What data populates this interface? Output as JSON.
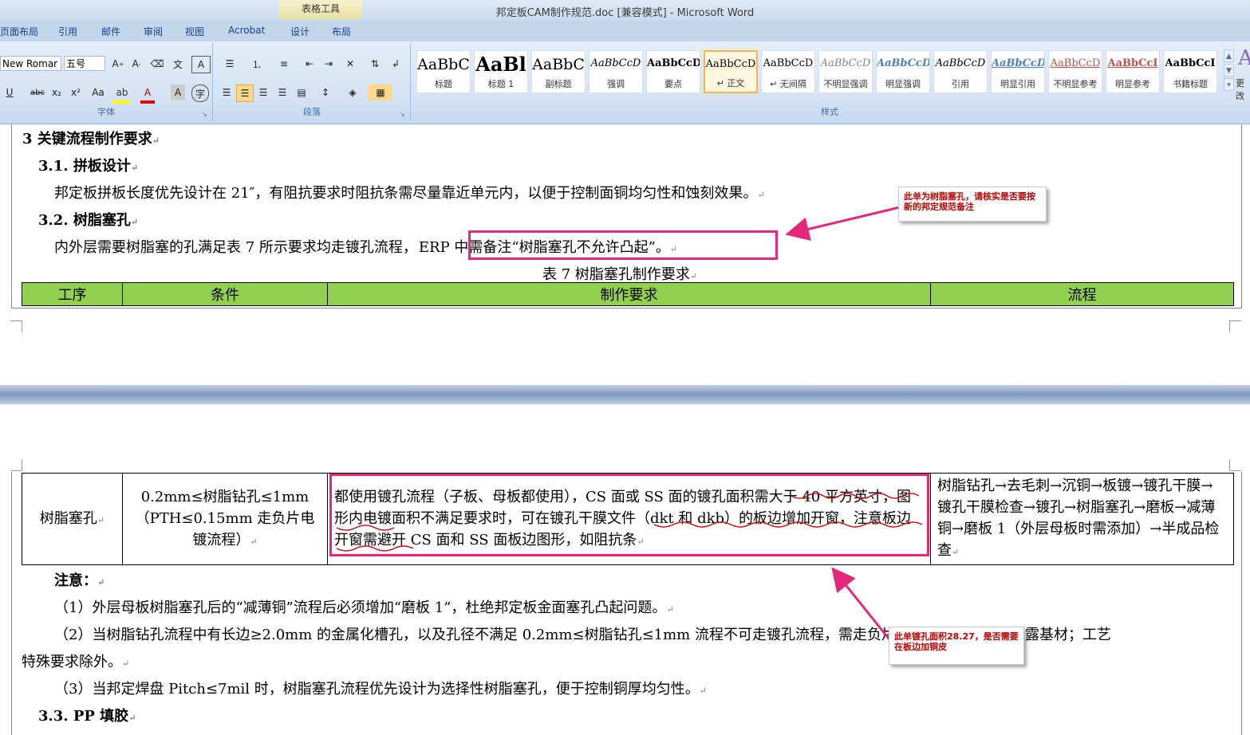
{
  "window": {
    "title": "邦定板CAM制作规范.doc [兼容模式] - Microsoft Word",
    "context_tab": "表格工具"
  },
  "ribbon_tabs": [
    "页面布局",
    "引用",
    "邮件",
    "审阅",
    "视图",
    "Acrobat",
    "设计",
    "布局"
  ],
  "ribbon": {
    "font_name": "New Romar",
    "font_size": "五号",
    "groups": [
      "字体",
      "段落",
      "样式"
    ],
    "more_label": "更改",
    "styles": [
      {
        "preview": "AaBbC",
        "name": "标题"
      },
      {
        "preview": "AaBl",
        "name": "标题 1"
      },
      {
        "preview": "AaBbC",
        "name": "副标题"
      },
      {
        "preview": "AaBbCcD",
        "name": "强调"
      },
      {
        "preview": "AaBbCcD",
        "name": "要点"
      },
      {
        "preview": "AaBbCcD",
        "name": "↵ 正文"
      },
      {
        "preview": "AaBbCcD",
        "name": "↵ 无间隔"
      },
      {
        "preview": "AaBbCcD",
        "name": "不明显强调"
      },
      {
        "preview": "AaBbCcD",
        "name": "明显强调"
      },
      {
        "preview": "AaBbCcD",
        "name": "引用"
      },
      {
        "preview": "AaBbCcD",
        "name": "明显引用"
      },
      {
        "preview": "AaBbCcD",
        "name": "不明显参考"
      },
      {
        "preview": "AaBbCcI",
        "name": "明显参考"
      },
      {
        "preview": "AaBbCcI",
        "name": "书籍标题"
      }
    ]
  },
  "doc": {
    "h3": "3 关键流程制作要求",
    "h31": "3.1.   拼板设计",
    "p31": "邦定板拼板长度优先设计在 21″，有阻抗要求时阻抗条需尽量靠近单元内，以便于控制面铜均匀性和蚀刻效果。",
    "h32": "3.2.   树脂塞孔",
    "p32_a": "内外层需要树脂塞的孔满足表 7 所示要求均走镀孔流程，",
    "p32_b": "ERP 中需备注“树脂塞孔不允许凸起”。",
    "table_caption": "表 7  树脂塞孔制作要求",
    "table_headers": [
      "工序",
      "条件",
      "制作要求",
      "流程"
    ],
    "row": {
      "process": "树脂塞孔",
      "condition": "0.2mm≤树脂钻孔≤1mm（PTH≤0.15mm 走负片电镀流程）",
      "requirement": "都使用镀孔流程（子板、母板都使用），CS 面或 SS 面的镀孔面积需大于 40 平方英寸，图形内电镀面积不满足要求时，可在镀孔干膜文件（dkt 和 dkb）的板边增加开窗，注意板边开窗需避开 CS 面和 SS 面板边图形，如阻抗条",
      "flow": "树脂钻孔→去毛刺→沉铜→板镀→镀孔干膜→镀孔干膜检查→镀孔→树脂塞孔→磨板→减薄铜→磨板 1（外层母板时需添加）→半成品检查"
    },
    "note_title": "注意：",
    "note1": "（1）外层母板树脂塞孔后的“减薄铜”流程后必须增加“磨板 1”，杜绝邦定板金面塞孔凸起问题。",
    "note2a": "（2）当树脂钻孔流程中有长边≥2.0mm 的金属化槽孔，以及孔径不满足 0.2mm≤树脂钻孔≤1mm 流程不可走镀孔流程，需走负片电镀，防止大孔磨板露基材；工艺",
    "note2b": "特殊要求除外。",
    "note3": "（3）当邦定焊盘 Pitch≤7mil 时，树脂塞孔流程优先设计为选择性树脂塞孔，便于控制铜厚均匀性。",
    "h33": "3.3.   PP 填胶"
  },
  "annotations": {
    "a1": "此单为树脂塞孔，请核实是否要按新的邦定规范备注",
    "a2": "此单镀孔面积28.27，是否需要在板边加铜皮"
  },
  "colors": {
    "table_header": "#92d050",
    "highlight": "#e5287a",
    "annotation_text": "#c00000"
  }
}
